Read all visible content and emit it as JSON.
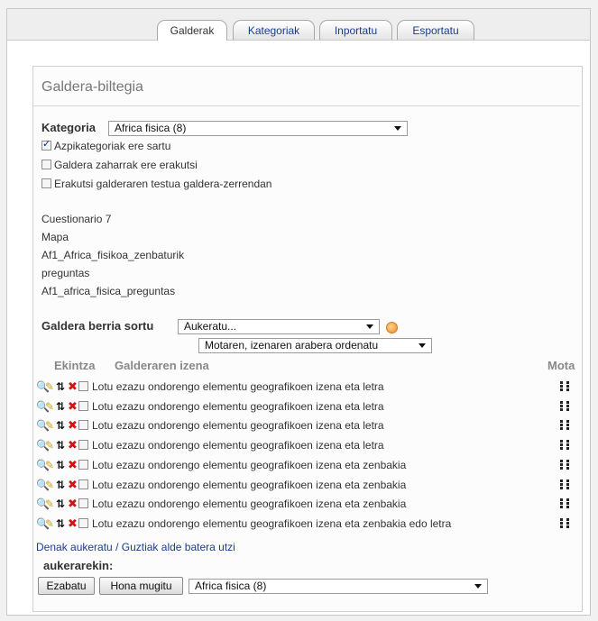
{
  "tabs": [
    {
      "label": "Galderak",
      "active": true
    },
    {
      "label": "Kategoriak",
      "active": false
    },
    {
      "label": "Inportatu",
      "active": false
    },
    {
      "label": "Esportatu",
      "active": false
    }
  ],
  "bank": {
    "title": "Galdera-biltegia",
    "category_label": "Kategoria",
    "category_value": "Africa fisica (8)",
    "options": [
      {
        "label": "Azpikategoriak ere sartu",
        "checked": true
      },
      {
        "label": "Galdera zaharrak ere erakutsi",
        "checked": false
      },
      {
        "label": "Erakutsi galderaren testua galdera-zerrendan",
        "checked": false
      }
    ],
    "info_lines": [
      "Cuestionario 7",
      "Mapa",
      "Af1_Africa_fisikoa_zenbaturik",
      "preguntas",
      "Af1_africa_fisica_preguntas"
    ],
    "new_question_label": "Galdera berria sortu",
    "new_question_value": "Aukeratu...",
    "sort_value": "Motaren, izenaren arabera ordenatu"
  },
  "table": {
    "col_action": "Ekintza",
    "col_name": "Galderaren izena",
    "col_type": "Mota",
    "rows": [
      "Lotu ezazu ondorengo elementu geografikoen izena eta letra",
      "Lotu ezazu ondorengo elementu geografikoen izena eta letra",
      "Lotu ezazu ondorengo elementu geografikoen izena eta letra",
      "Lotu ezazu ondorengo elementu geografikoen izena eta letra",
      "Lotu ezazu ondorengo elementu geografikoen izena eta zenbakia",
      "Lotu ezazu ondorengo elementu geografikoen izena eta zenbakia",
      "Lotu ezazu ondorengo elementu geografikoen izena eta zenbakia",
      "Lotu ezazu ondorengo elementu geografikoen izena eta zenbakia edo letra"
    ]
  },
  "bulk": {
    "select_all": "Denak aukeratu",
    "separator": " / ",
    "deselect_all": "Guztiak alde batera utzi",
    "with_label": "aukerarekin:",
    "delete_button": "Ezabatu",
    "move_button": "Hona mugitu",
    "target_category": "Africa fisica (8)"
  },
  "icons": {
    "row_actions": [
      "preview-icon",
      "edit-icon",
      "move-icon",
      "delete-icon"
    ],
    "question_type": "matching-question-icon",
    "help": "help-icon"
  },
  "colors": {
    "link": "#1a3d8c",
    "delete": "#d41212",
    "panel_border": "#d0d0d0"
  }
}
